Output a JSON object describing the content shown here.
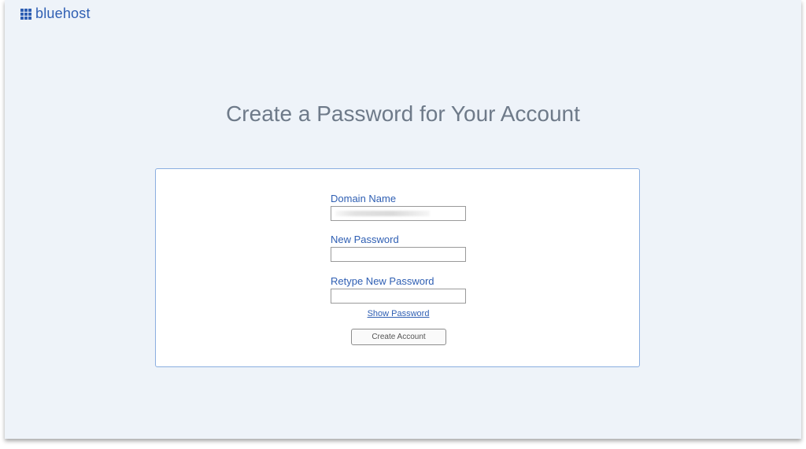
{
  "brand": {
    "name": "bluehost",
    "color": "#2f5fb3",
    "icon": "grid-logo-icon"
  },
  "page": {
    "title": "Create a Password for Your Account"
  },
  "form": {
    "domain_name": {
      "label": "Domain Name",
      "value_note": "blurred"
    },
    "new_password": {
      "label": "New Password",
      "value": ""
    },
    "retype_password": {
      "label": "Retype New Password",
      "value": ""
    },
    "show_password_label": "Show Password",
    "submit_label": "Create Account"
  },
  "colors": {
    "background": "#eef3f9",
    "card_border": "#8aaee0",
    "label": "#2f5fb3",
    "title": "#6e7a89"
  }
}
